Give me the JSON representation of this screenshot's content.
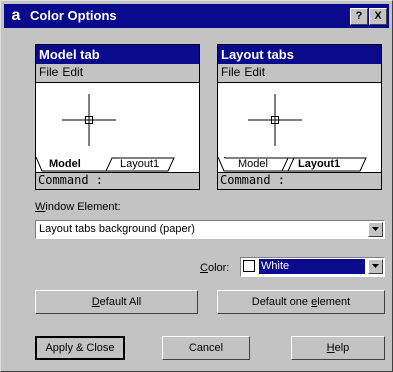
{
  "window": {
    "app_icon": "a",
    "title": "Color Options",
    "help_button": "?",
    "close_button": "X"
  },
  "previews": [
    {
      "title": "Model tab",
      "menu": [
        "File",
        "Edit"
      ],
      "tabs": [
        "Model",
        "Layout1"
      ],
      "active_tab": "Model",
      "command": "Command :"
    },
    {
      "title": "Layout tabs",
      "menu": [
        "File",
        "Edit"
      ],
      "tabs": [
        "Model",
        "Layout1"
      ],
      "active_tab": "Layout1",
      "command": "Command :"
    }
  ],
  "window_element": {
    "label_prefix": "",
    "label_accel": "W",
    "label_rest": "indow Element:",
    "value": "Layout tabs background (paper)"
  },
  "color": {
    "label_accel": "C",
    "label_rest": "olor:",
    "value": "White",
    "swatch": "#ffffff",
    "highlight": "#0a0a8c"
  },
  "buttons": {
    "default_all": {
      "accel": "D",
      "rest": "efault All"
    },
    "default_one": {
      "prefix": "Default one ",
      "accel": "e",
      "rest": "lement"
    },
    "apply_close": "Apply & Close",
    "cancel": "Cancel",
    "help": {
      "accel": "H",
      "rest": "elp"
    }
  }
}
